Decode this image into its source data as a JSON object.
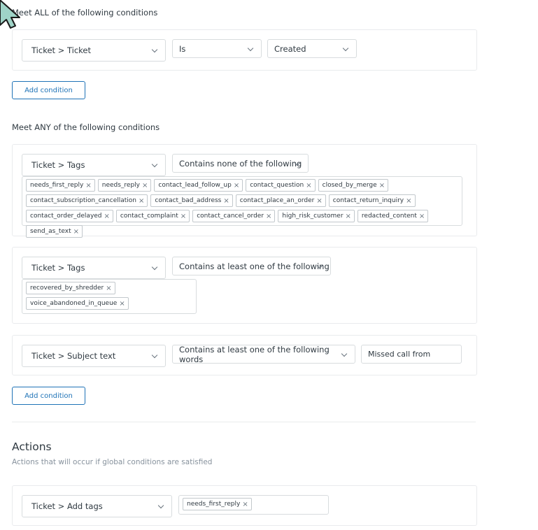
{
  "all_conditions": {
    "title": "Meet ALL of the following conditions",
    "field": "Ticket > Ticket",
    "operator": "Is",
    "value": "Created",
    "add_button": "Add condition"
  },
  "any_conditions": {
    "title": "Meet ANY of the following conditions",
    "condition1": {
      "field": "Ticket > Tags",
      "operator": "Contains none of the following",
      "tags": [
        "needs_first_reply",
        "needs_reply",
        "contact_lead_follow_up",
        "contact_question",
        "closed_by_merge",
        "contact_subscription_cancellation",
        "contact_bad_address",
        "contact_place_an_order",
        "contact_return_inquiry",
        "contact_order_delayed",
        "contact_complaint",
        "contact_cancel_order",
        "high_risk_customer",
        "redacted_content",
        "send_as_text"
      ]
    },
    "condition2": {
      "field": "Ticket > Tags",
      "operator": "Contains at least one of the following",
      "tags": [
        "recovered_by_shredder",
        "voice_abandoned_in_queue"
      ]
    },
    "condition3": {
      "field": "Ticket > Subject text",
      "operator": "Contains at least one of the following words",
      "value": "Missed call from"
    },
    "add_button": "Add condition"
  },
  "actions": {
    "title": "Actions",
    "subtitle": "Actions that will occur if global conditions are satisfied",
    "field": "Ticket > Add tags",
    "tags": [
      "needs_first_reply"
    ]
  },
  "icons": {
    "chevron": "chevron-down-icon",
    "remove": "close-icon",
    "cursor": "mouse-pointer-icon"
  },
  "colors": {
    "primary": "#1f73b7",
    "border": "#d8dcde",
    "text": "#2f3941",
    "muted": "#68737d",
    "cursor": "#9fd3c7"
  }
}
